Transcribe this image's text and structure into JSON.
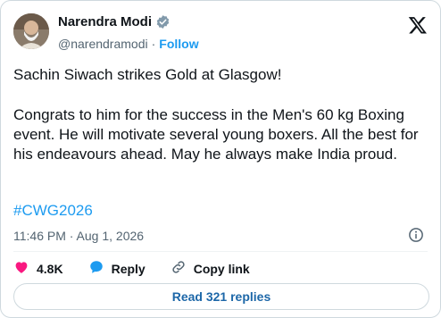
{
  "author": {
    "name": "Narendra Modi",
    "handle": "@narendramodi",
    "separator": "·",
    "follow_label": "Follow"
  },
  "tweet": {
    "line1": "Sachin Siwach strikes Gold at Glasgow!",
    "paragraph2": "Congrats to him for the success in the Men's 60 kg Boxing event. He will motivate several young boxers. All the best for his endeavours ahead. May he always make India proud.",
    "hashtag": "#CWG2026",
    "timestamp": "11:46 PM · Aug 1, 2026"
  },
  "actions": {
    "likes": "4.8K",
    "reply": "Reply",
    "copy_link": "Copy link"
  },
  "footer": {
    "read_replies": "Read 321 replies"
  },
  "icons": {
    "verified": "verified-badge-icon",
    "x_logo": "x-logo-icon",
    "info": "info-icon",
    "heart": "heart-icon",
    "reply": "reply-bubble-icon",
    "link": "link-icon"
  },
  "colors": {
    "accent": "#1d9bf0",
    "like": "#f91880",
    "text": "#0f1419",
    "muted": "#536471",
    "border": "#cfd9de"
  }
}
